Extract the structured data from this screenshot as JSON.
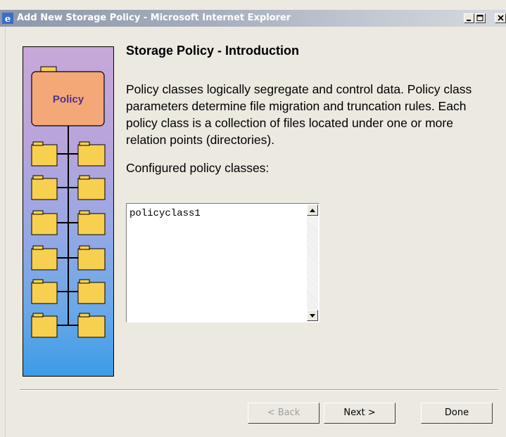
{
  "window": {
    "title": "Add New Storage Policy - Microsoft Internet Explorer",
    "controls": [
      "minimize",
      "maximize",
      "close"
    ]
  },
  "illustration": {
    "policy_label": "Policy",
    "folder_rows": 6
  },
  "main": {
    "heading": "Storage Policy - Introduction",
    "description": "Policy classes logically segregate and control data. Policy class parameters determine file migration and truncation rules. Each policy class is a collection of files located under one or more relation points (directories).",
    "configured_label": "Configured policy classes:",
    "policy_classes": [
      "policyclass1"
    ]
  },
  "buttons": {
    "back": "< Back",
    "next": "Next >",
    "done": "Done"
  },
  "colors": {
    "window_bg": "#ece9e1",
    "titlebar_inactive": "#a4adbb",
    "folder_fill": "#f8d050",
    "policy_box_fill": "#f4a878"
  }
}
